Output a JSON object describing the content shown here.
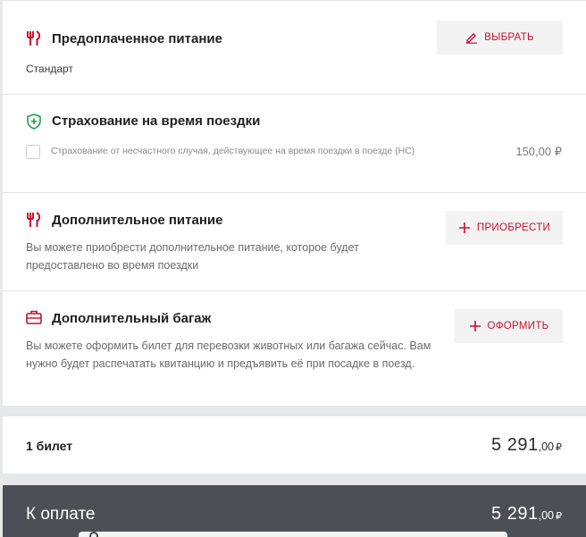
{
  "meal": {
    "title": "Предоплаченное питание",
    "subtitle": "Стандарт",
    "button": "ВЫБРАТЬ",
    "icon": "fork-knife-icon"
  },
  "insurance": {
    "title": "Страхование на время поездки",
    "option_text": "Страхование от несчастного случая, действующее на время поездки в поезде (НС)",
    "price": "150,00 ₽",
    "icon": "shield-plus-icon"
  },
  "extra_meal": {
    "title": "Дополнительное питание",
    "description": "Вы можете приобрести дополнительное питание, которое будет предоставлено во время поездки",
    "button": "ПРИОБРЕСТИ",
    "icon": "fork-knife-icon"
  },
  "baggage": {
    "title": "Дополнительный багаж",
    "description": "Вы можете оформить билет для перевозки животных или багажа сейчас. Вам нужно будет распечатать квитанцию и предъявить её при посадке в поезд.",
    "button": "ОФОРМИТЬ",
    "icon": "suitcase-icon"
  },
  "tickets": {
    "label": "1 билет",
    "price_int": "5 291",
    "price_dec": ",00",
    "currency": "₽"
  },
  "payment": {
    "label": "К оплате",
    "price_int": "5 291",
    "price_dec": ",00",
    "currency": "₽"
  },
  "colors": {
    "accent": "#c8102e",
    "shield": "#1aa34a",
    "pay_bar": "#4c5056"
  }
}
